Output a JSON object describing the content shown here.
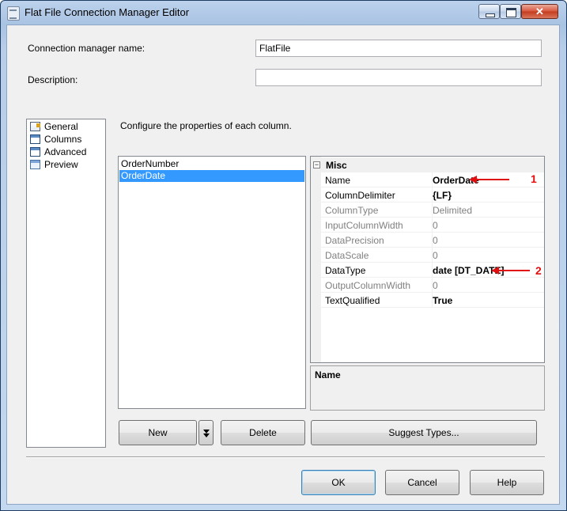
{
  "window": {
    "title": "Flat File Connection Manager Editor"
  },
  "form": {
    "connection_label": "Connection manager name:",
    "connection_value": "FlatFile",
    "description_label": "Description:",
    "description_value": ""
  },
  "nav": {
    "items": [
      {
        "label": "General",
        "icon": "general-icon"
      },
      {
        "label": "Columns",
        "icon": "columns-icon"
      },
      {
        "label": "Advanced",
        "icon": "advanced-icon"
      },
      {
        "label": "Preview",
        "icon": "preview-icon"
      }
    ],
    "selected": "Advanced"
  },
  "main": {
    "instruction": "Configure the properties of each column.",
    "columns": [
      "OrderNumber",
      "OrderDate"
    ],
    "selected_column": "OrderDate"
  },
  "properties": {
    "category": "Misc",
    "toggle": "⊟",
    "rows": [
      {
        "name": "Name",
        "value": "OrderDate",
        "readonly": false,
        "bold": true
      },
      {
        "name": "ColumnDelimiter",
        "value": "{LF}",
        "readonly": false,
        "bold": true
      },
      {
        "name": "ColumnType",
        "value": "Delimited",
        "readonly": true,
        "bold": false
      },
      {
        "name": "InputColumnWidth",
        "value": "0",
        "readonly": true,
        "bold": false
      },
      {
        "name": "DataPrecision",
        "value": "0",
        "readonly": true,
        "bold": false
      },
      {
        "name": "DataScale",
        "value": "0",
        "readonly": true,
        "bold": false
      },
      {
        "name": "DataType",
        "value": "date [DT_DATE]",
        "readonly": false,
        "bold": true
      },
      {
        "name": "OutputColumnWidth",
        "value": "0",
        "readonly": true,
        "bold": false
      },
      {
        "name": "TextQualified",
        "value": "True",
        "readonly": false,
        "bold": true
      }
    ],
    "description_title": "Name"
  },
  "buttons": {
    "new": "New",
    "delete": "Delete",
    "suggest": "Suggest Types...",
    "ok": "OK",
    "cancel": "Cancel",
    "help": "Help"
  },
  "annotations": {
    "marker_1": "1",
    "marker_2": "2",
    "color": "#e01010"
  }
}
